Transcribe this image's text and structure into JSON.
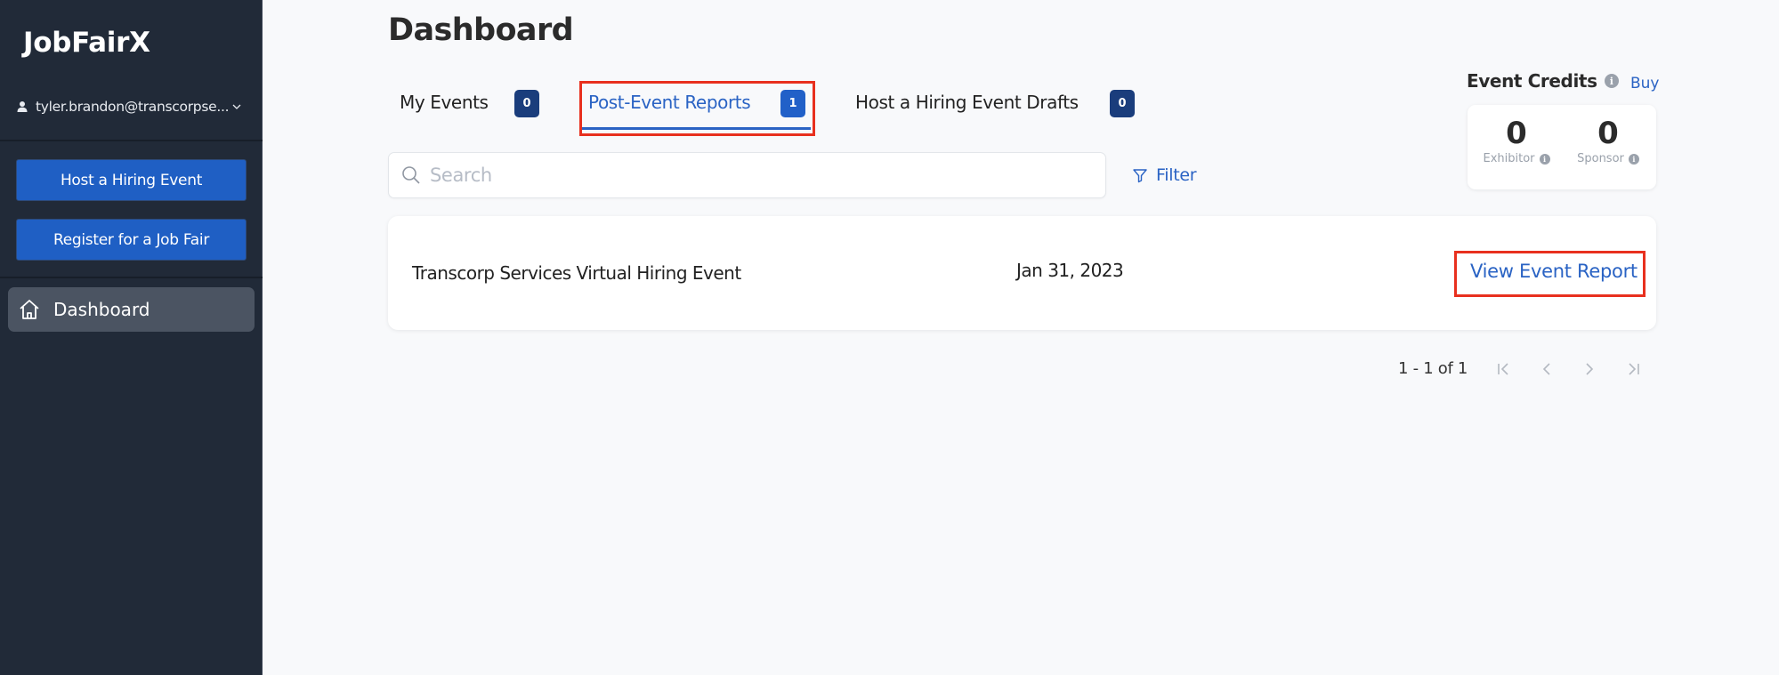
{
  "app": {
    "brand": "JobFairX",
    "user_email": "tyler.brandon@transcorpse..."
  },
  "sidebar": {
    "buttons": [
      {
        "label": "Host a Hiring Event"
      },
      {
        "label": "Register for a Job Fair"
      }
    ],
    "nav": [
      {
        "label": "Dashboard",
        "icon": "home-icon",
        "active": true
      }
    ]
  },
  "main": {
    "title": "Dashboard",
    "tabs": [
      {
        "label": "My Events",
        "count": "0",
        "active": false
      },
      {
        "label": "Post-Event Reports",
        "count": "1",
        "active": true
      },
      {
        "label": "Host a Hiring Event Drafts",
        "count": "0",
        "active": false
      }
    ],
    "search": {
      "placeholder": "Search",
      "value": ""
    },
    "filter_label": "Filter",
    "events": [
      {
        "name": "Transcorp Services Virtual Hiring Event",
        "date": "Jan 31, 2023",
        "action": "View Event Report"
      }
    ],
    "pagination": {
      "range_text": "1 - 1 of 1"
    }
  },
  "credits": {
    "title": "Event Credits",
    "buy_label": "Buy",
    "items": [
      {
        "value": "0",
        "label": "Exhibitor"
      },
      {
        "value": "0",
        "label": "Sponsor"
      }
    ]
  },
  "colors": {
    "sidebar_bg": "#212a38",
    "primary": "#1f5fc4",
    "link": "#2a63c4",
    "badge": "#1a3d7c",
    "highlight": "#e8301e"
  }
}
